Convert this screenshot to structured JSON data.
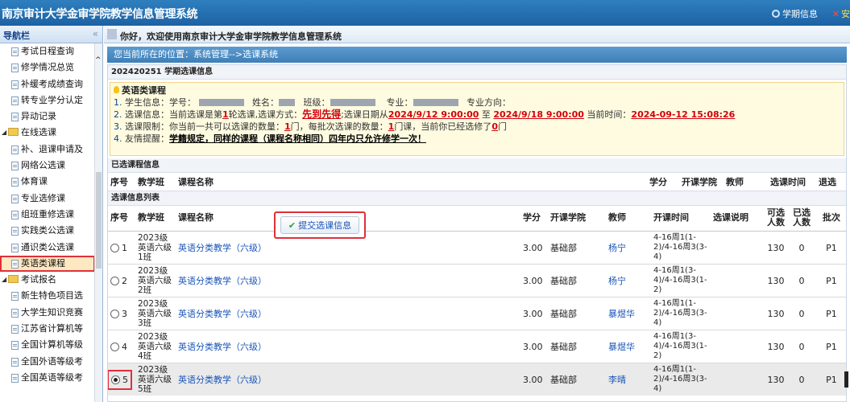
{
  "app": {
    "title": "南京审计大学金审学院教学信息管理系统",
    "term_info": "学期信息",
    "safe_exit": "安"
  },
  "sidebar": {
    "title": "导航栏",
    "items": [
      {
        "type": "leaf",
        "label": "考试日程查询"
      },
      {
        "type": "leaf",
        "label": "修学情况总览"
      },
      {
        "type": "leaf",
        "label": "补缓考成绩查询"
      },
      {
        "type": "leaf",
        "label": "转专业学分认定"
      },
      {
        "type": "leaf",
        "label": "异动记录"
      },
      {
        "type": "folder",
        "label": "在线选课"
      },
      {
        "type": "leaf",
        "label": "补、退课申请及"
      },
      {
        "type": "leaf",
        "label": "网络公选课"
      },
      {
        "type": "leaf",
        "label": "体育课"
      },
      {
        "type": "leaf",
        "label": "专业选修课"
      },
      {
        "type": "leaf",
        "label": "组班重修选课"
      },
      {
        "type": "leaf",
        "label": "实践类公选课"
      },
      {
        "type": "leaf",
        "label": "通识类公选课"
      },
      {
        "type": "leaf",
        "label": "英语类课程",
        "selected": true
      },
      {
        "type": "folder",
        "label": "考试报名"
      },
      {
        "type": "leaf",
        "label": "新生特色项目选"
      },
      {
        "type": "leaf",
        "label": "大学生知识竞赛"
      },
      {
        "type": "leaf",
        "label": "江苏省计算机等"
      },
      {
        "type": "leaf",
        "label": "全国计算机等级"
      },
      {
        "type": "leaf",
        "label": "全国外语等级考"
      },
      {
        "type": "leaf",
        "label": "全国英语等级考"
      }
    ]
  },
  "welcome": "你好，欢迎使用南京审计大学金审学院教学信息管理系统",
  "location": "您当前所在的位置：系统管理-->选课系统",
  "term_section": "202420251 学期选课信息",
  "notice": {
    "title": "英语类课程",
    "l1_label": "学生信息：学号：",
    "l1_name": "姓名：",
    "l1_class": "班级：",
    "l1_major": "专业：",
    "l1_direction": "专业方向：",
    "l2_a": "选课信息：当前选课是第",
    "l2_round": "1",
    "l2_b": "轮选课,选课方式：",
    "l2_mode": "先到先得",
    "l2_c": ";选课日期从",
    "l2_start": "2024/9/12 9:00:00",
    "l2_to": "至",
    "l2_end": "2024/9/18 9:00:00",
    "l2_now_label": "当前时间：",
    "l2_now": "2024-09-12 15:08:26",
    "l3_a": "选课限制：你当前一共可以选课的数量：",
    "l3_total": "1",
    "l3_b": "门，每批次选课的数量：",
    "l3_batch": "1",
    "l3_c": "门课，当前你已经选修了",
    "l3_done": "0",
    "l3_d": "门",
    "l4_a": "友情提醒：",
    "l4_b": "学籍规定，同样的课程（课程名称相同）四年内只允许修学一次！"
  },
  "selected_section": "已选课程信息",
  "selected_headers": [
    "序号",
    "教学班",
    "课程名称",
    "学分",
    "开课学院",
    "教师",
    "选课时间",
    "退选"
  ],
  "list_section": "选课信息列表",
  "submit_label": "提交选课信息",
  "course_headers": [
    "序号",
    "教学班",
    "课程名称",
    "学分",
    "开课学院",
    "教师",
    "开课时间",
    "选课说明",
    "可选人数",
    "已选人数",
    "批次"
  ],
  "courses": [
    {
      "no": "1",
      "cls": "2023级英语六级1班",
      "name": "英语分类教学（六级）",
      "credit": "3.00",
      "college": "基础部",
      "teacher": "杨宁",
      "time": "4-16周1(1-2)/4-16周3(3-4)",
      "note": "",
      "cap": "130",
      "sel": "0",
      "batch": "P1",
      "checked": false
    },
    {
      "no": "2",
      "cls": "2023级英语六级2班",
      "name": "英语分类教学（六级）",
      "credit": "3.00",
      "college": "基础部",
      "teacher": "杨宁",
      "time": "4-16周1(3-4)/4-16周3(1-2)",
      "note": "",
      "cap": "130",
      "sel": "0",
      "batch": "P1",
      "checked": false
    },
    {
      "no": "3",
      "cls": "2023级英语六级3班",
      "name": "英语分类教学（六级）",
      "credit": "3.00",
      "college": "基础部",
      "teacher": "暴煜华",
      "time": "4-16周1(1-2)/4-16周3(3-4)",
      "note": "",
      "cap": "130",
      "sel": "0",
      "batch": "P1",
      "checked": false
    },
    {
      "no": "4",
      "cls": "2023级英语六级4班",
      "name": "英语分类教学（六级）",
      "credit": "3.00",
      "college": "基础部",
      "teacher": "暴煜华",
      "time": "4-16周1(3-4)/4-16周3(1-2)",
      "note": "",
      "cap": "130",
      "sel": "0",
      "batch": "P1",
      "checked": false
    },
    {
      "no": "5",
      "cls": "2023级英语六级5班",
      "name": "英语分类教学（六级）",
      "credit": "3.00",
      "college": "基础部",
      "teacher": "李晴",
      "time": "4-16周1(1-2)/4-16周3(3-4)",
      "note": "",
      "cap": "130",
      "sel": "0",
      "batch": "P1",
      "checked": true
    }
  ]
}
